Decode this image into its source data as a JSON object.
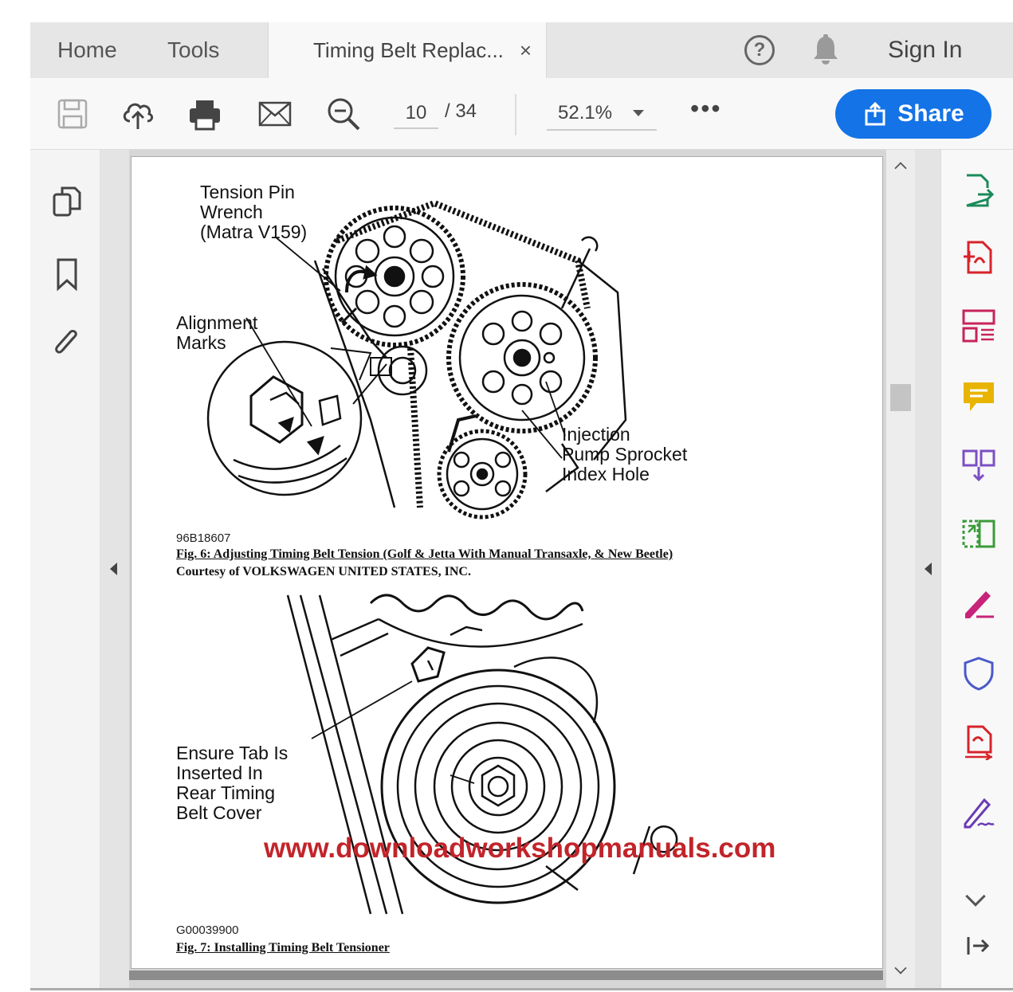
{
  "tabs": {
    "home": "Home",
    "tools": "Tools",
    "document": "Timing Belt Replac...",
    "close": "×"
  },
  "header": {
    "help": "?",
    "sign_in": "Sign In"
  },
  "toolbar": {
    "current_page": "10",
    "total_pages": "/ 34",
    "zoom": "52.1%",
    "more": "•••",
    "share_label": "Share"
  },
  "document": {
    "fig6": {
      "label_tension_pin": "Tension Pin\nWrench\n(Matra V159)",
      "label_alignment": "Alignment\nMarks",
      "label_injection": "Injection\nPump Sprocket\nIndex Hole",
      "code": "96B18607",
      "caption": "Fig. 6: Adjusting Timing Belt Tension (Golf & Jetta With Manual Transaxle, & New Beetle)",
      "courtesy": "Courtesy of VOLKSWAGEN UNITED STATES, INC."
    },
    "fig7": {
      "label_tab": "Ensure Tab Is\nInserted In\nRear Timing\nBelt Cover",
      "code": "G00039900",
      "caption": "Fig. 7: Installing Timing Belt Tensioner"
    },
    "watermark": "www.downloadworkshopmanuals.com"
  },
  "colors": {
    "share_button": "#1473e6",
    "watermark": "#c2242a",
    "tool_export": "#1a8a5a",
    "tool_create": "#d8232a",
    "tool_organize": "#c8235a",
    "tool_comment": "#e8b400",
    "tool_combine": "#7c4fc4",
    "tool_compress": "#3a9b3a",
    "tool_fill_sign": "#c8237a",
    "tool_protect": "#4a5ac8",
    "tool_export_red": "#d8232a",
    "tool_request_sign": "#6a3ab4"
  }
}
